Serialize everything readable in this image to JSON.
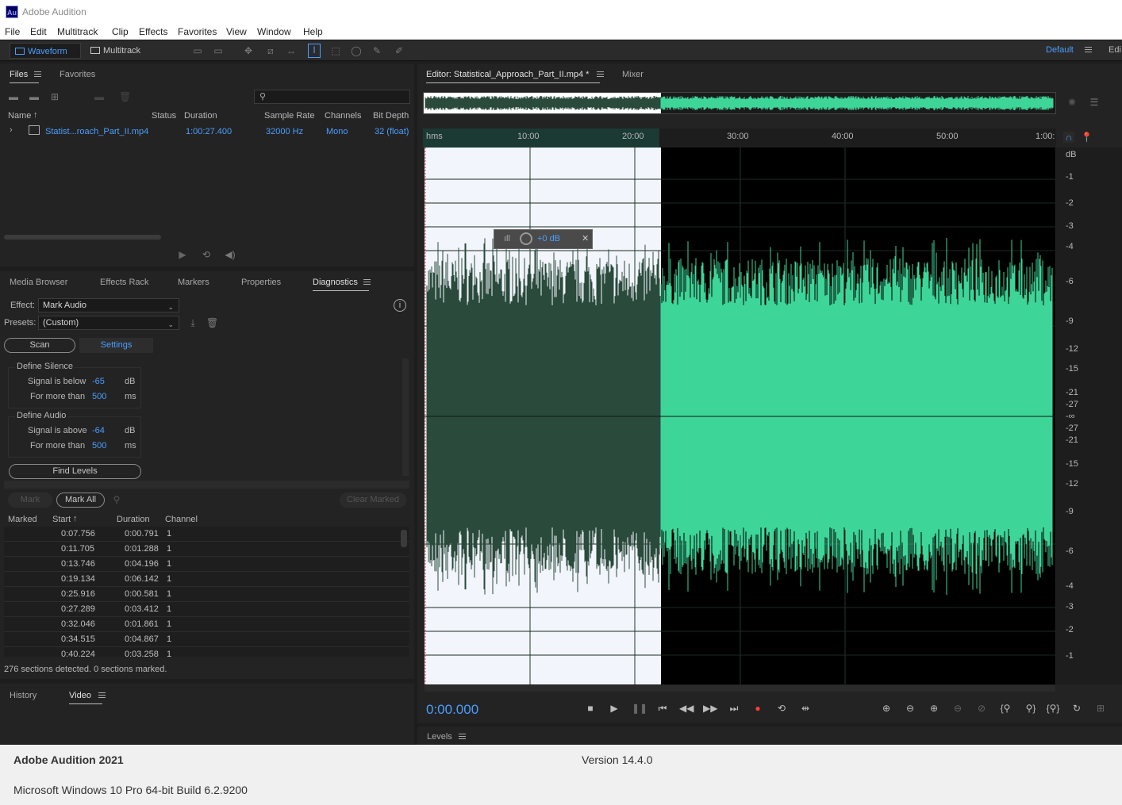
{
  "window": {
    "title": "Adobe Audition",
    "logo_text": "Au"
  },
  "menu": [
    "File",
    "Edit",
    "Multitrack",
    "Clip",
    "Effects",
    "Favorites",
    "View",
    "Window",
    "Help"
  ],
  "toolbar": {
    "waveform_label": "Waveform",
    "multitrack_label": "Multitrack",
    "workspace_label": "Default",
    "edit_label": "Edi"
  },
  "files_panel": {
    "tabs": [
      "Files",
      "Favorites"
    ],
    "columns": [
      "Name",
      "Status",
      "Duration",
      "Sample Rate",
      "Channels",
      "Bit Depth"
    ],
    "file": {
      "name": "Statist...roach_Part_II.mp4",
      "duration": "1:00:27.400",
      "sample_rate": "32000 Hz",
      "channels": "Mono",
      "bit_depth": "32 (float)"
    }
  },
  "lower_tabs": [
    "Media Browser",
    "Effects Rack",
    "Markers",
    "Properties",
    "Diagnostics"
  ],
  "diagnostics": {
    "effect_label": "Effect:",
    "effect_value": "Mark Audio",
    "presets_label": "Presets:",
    "presets_value": "(Custom)",
    "scan_label": "Scan",
    "settings_label": "Settings",
    "define_silence": "Define Silence",
    "define_audio": "Define Audio",
    "signal_below": "Signal is below",
    "signal_above": "Signal is above",
    "for_more_than": "For more than",
    "silence_db": "-65",
    "silence_ms": "500",
    "audio_db": "-64",
    "audio_ms": "500",
    "unit_db": "dB",
    "unit_ms": "ms",
    "find_levels": "Find Levels",
    "mark": "Mark",
    "mark_all": "Mark All",
    "clear_marked": "Clear Marked",
    "table_columns": [
      "Marked",
      "Start",
      "Duration",
      "Channel"
    ],
    "rows": [
      {
        "start": "0:07.756",
        "duration": "0:00.791",
        "channel": "1"
      },
      {
        "start": "0:11.705",
        "duration": "0:01.288",
        "channel": "1"
      },
      {
        "start": "0:13.746",
        "duration": "0:04.196",
        "channel": "1"
      },
      {
        "start": "0:19.134",
        "duration": "0:06.142",
        "channel": "1"
      },
      {
        "start": "0:25.916",
        "duration": "0:00.581",
        "channel": "1"
      },
      {
        "start": "0:27.289",
        "duration": "0:03.412",
        "channel": "1"
      },
      {
        "start": "0:32.046",
        "duration": "0:01.861",
        "channel": "1"
      },
      {
        "start": "0:34.515",
        "duration": "0:04.867",
        "channel": "1"
      },
      {
        "start": "0:40.224",
        "duration": "0:03.258",
        "channel": "1"
      }
    ],
    "status": "276 sections detected. 0 sections marked."
  },
  "bottom_tabs": [
    "History",
    "Video"
  ],
  "editor": {
    "tab_label": "Editor: Statistical_Approach_Part_II.mp4 *",
    "mixer_label": "Mixer",
    "time_labels": [
      "hms",
      "10:00",
      "20:00",
      "30:00",
      "40:00",
      "50:00",
      "1:00:"
    ],
    "db_labels": [
      "dB",
      "-1",
      "-2",
      "-3",
      "-4",
      "-6",
      "-9",
      "-12",
      "-15",
      "-21",
      "-27",
      "-∞",
      "-27",
      "-21",
      "-15",
      "-12",
      "-9",
      "-6",
      "-4",
      "-3",
      "-2",
      "-1"
    ],
    "hud_value": "+0 dB",
    "current_time": "0:00.000",
    "selection_fraction": 0.375
  },
  "levels_label": "Levels",
  "about": {
    "product": "Adobe Audition 2021",
    "version": "Version 14.4.0",
    "os": "Microsoft Windows 10 Pro 64-bit Build 6.2.9200"
  },
  "colors": {
    "accent": "#4a9eff",
    "waveform": "#3ed598",
    "waveform_selected_dim": "#2a4a3c",
    "selection_bg": "#f2f5fb"
  }
}
